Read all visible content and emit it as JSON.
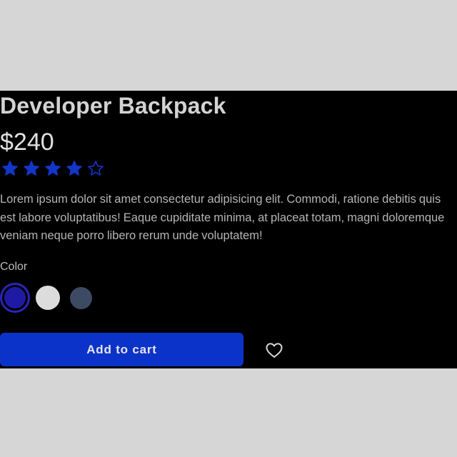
{
  "product": {
    "name": "Developer Backpack",
    "price": "$240",
    "rating": 4,
    "rating_max": 5,
    "description": "Lorem ipsum dolor sit amet consectetur adipisicing elit. Commodi, ratione debitis quis est labore voluptatibus! Eaque cupiditate minima, at placeat totam, magni doloremque veniam neque porro libero rerum unde voluptatem!"
  },
  "color_picker": {
    "label": "Color",
    "options": [
      {
        "color": "#1f1aa3",
        "ring_color": "#2a25b8",
        "selected": true
      },
      {
        "color": "#dcdcdc",
        "selected": false
      },
      {
        "color": "#3d4a63",
        "selected": false
      }
    ]
  },
  "actions": {
    "add_to_cart_label": "Add to cart",
    "favorite_icon": "heart-icon"
  },
  "colors": {
    "accent": "#0c33c9",
    "star": "#1336c8",
    "panel_bg": "#000000",
    "page_bg": "#d6d6d6"
  }
}
